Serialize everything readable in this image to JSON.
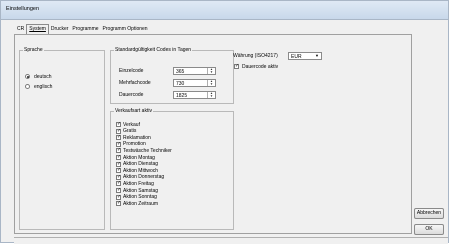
{
  "window": {
    "title": "Einstellungen"
  },
  "tabs": [
    {
      "label": "CR"
    },
    {
      "label": "System",
      "active": true
    },
    {
      "label": "Drucker"
    },
    {
      "label": "Programme"
    },
    {
      "label": "Programm Optionen"
    }
  ],
  "sprache": {
    "legend": "Sprache",
    "options": [
      {
        "label": "deutsch",
        "selected": true
      },
      {
        "label": "englisch",
        "selected": false
      }
    ]
  },
  "gueltigkeit": {
    "legend": "Standardgültigkeit Codes in Tagen",
    "fields": [
      {
        "label": "Einzelcode",
        "value": "365"
      },
      {
        "label": "Mehrfachcode",
        "value": "730"
      },
      {
        "label": "Dauercode",
        "value": "1825"
      }
    ]
  },
  "verkaufsart": {
    "legend": "Verkaufsart aktiv",
    "items": [
      "Verkauf",
      "Gratis",
      "Reklamation",
      "Promotion",
      "Testwäsche Techniker",
      "Aktion Montag",
      "Aktion Dienstag",
      "Aktion Mittwoch",
      "Aktion Donnerstag",
      "Aktion Freitag",
      "Aktion Samstag",
      "Aktion Sonntag",
      "Aktion Zeitraum"
    ]
  },
  "waehrung": {
    "label": "Währung (ISO4217)",
    "value": "EUR"
  },
  "dauercode": {
    "label": "Dauercode aktiv",
    "checked": true
  },
  "buttons": {
    "cancel": "Abbrechen",
    "ok": "OK"
  }
}
